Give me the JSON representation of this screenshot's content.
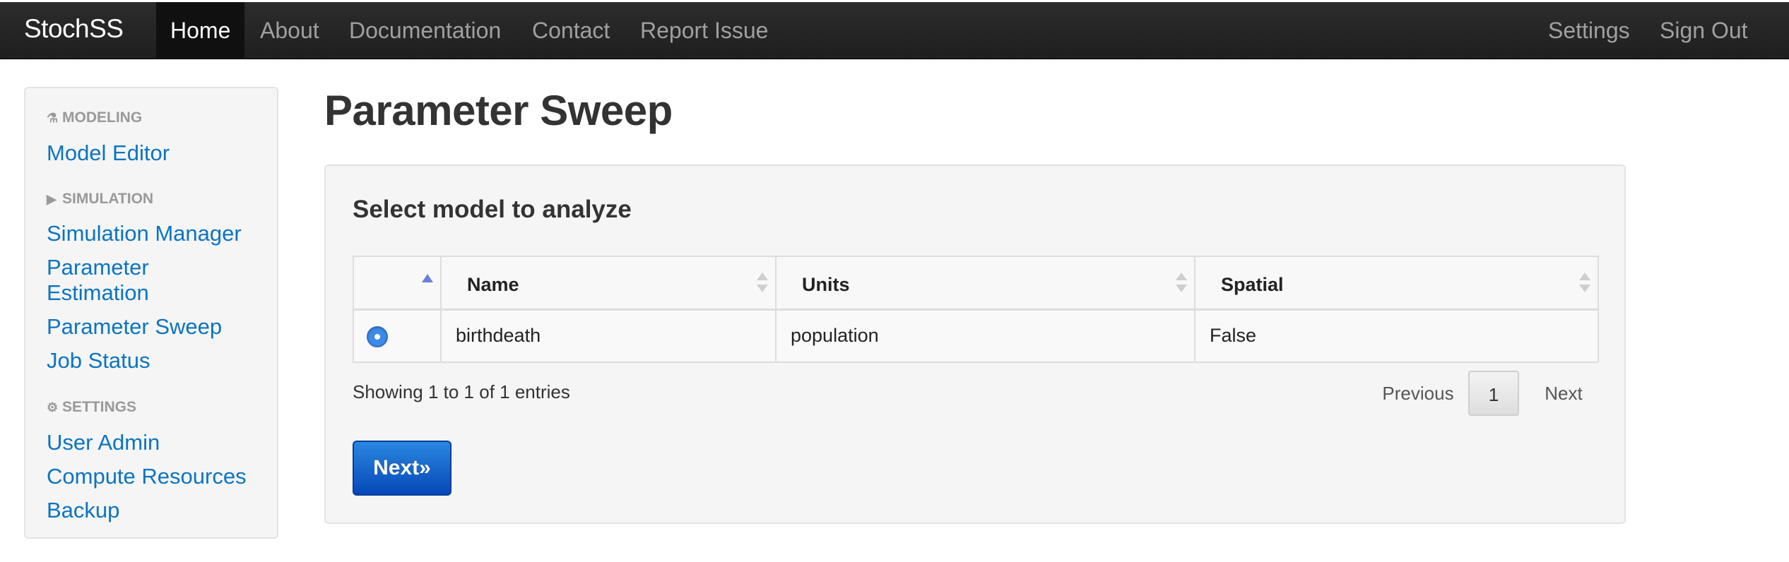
{
  "nav": {
    "brand": "StochSS",
    "home": "Home",
    "about": "About",
    "documentation": "Documentation",
    "contact": "Contact",
    "report_issue": "Report Issue",
    "settings": "Settings",
    "sign_out": "Sign Out"
  },
  "sidebar": {
    "modeling_header": "MODELING",
    "model_editor": "Model Editor",
    "simulation_header": "SIMULATION",
    "simulation_manager": "Simulation Manager",
    "parameter_estimation": "Parameter Estimation",
    "parameter_sweep": "Parameter Sweep",
    "job_status": "Job Status",
    "settings_header": "SETTINGS",
    "user_admin": "User Admin",
    "compute_resources": "Compute Resources",
    "backup": "Backup"
  },
  "main": {
    "title": "Parameter Sweep",
    "panel_heading": "Select model to analyze",
    "table": {
      "columns": [
        "",
        "Name",
        "Units",
        "Spatial"
      ],
      "rows": [
        {
          "selected": true,
          "name": "birthdeath",
          "units": "population",
          "spatial": "False"
        }
      ]
    },
    "info": "Showing 1 to 1 of 1 entries",
    "pagination": {
      "previous": "Previous",
      "current": "1",
      "next": "Next"
    },
    "next_button": "Next»"
  },
  "colors": {
    "link": "#0b74c2",
    "navbar": "#222222",
    "primary_button": "#0a5fd0"
  }
}
